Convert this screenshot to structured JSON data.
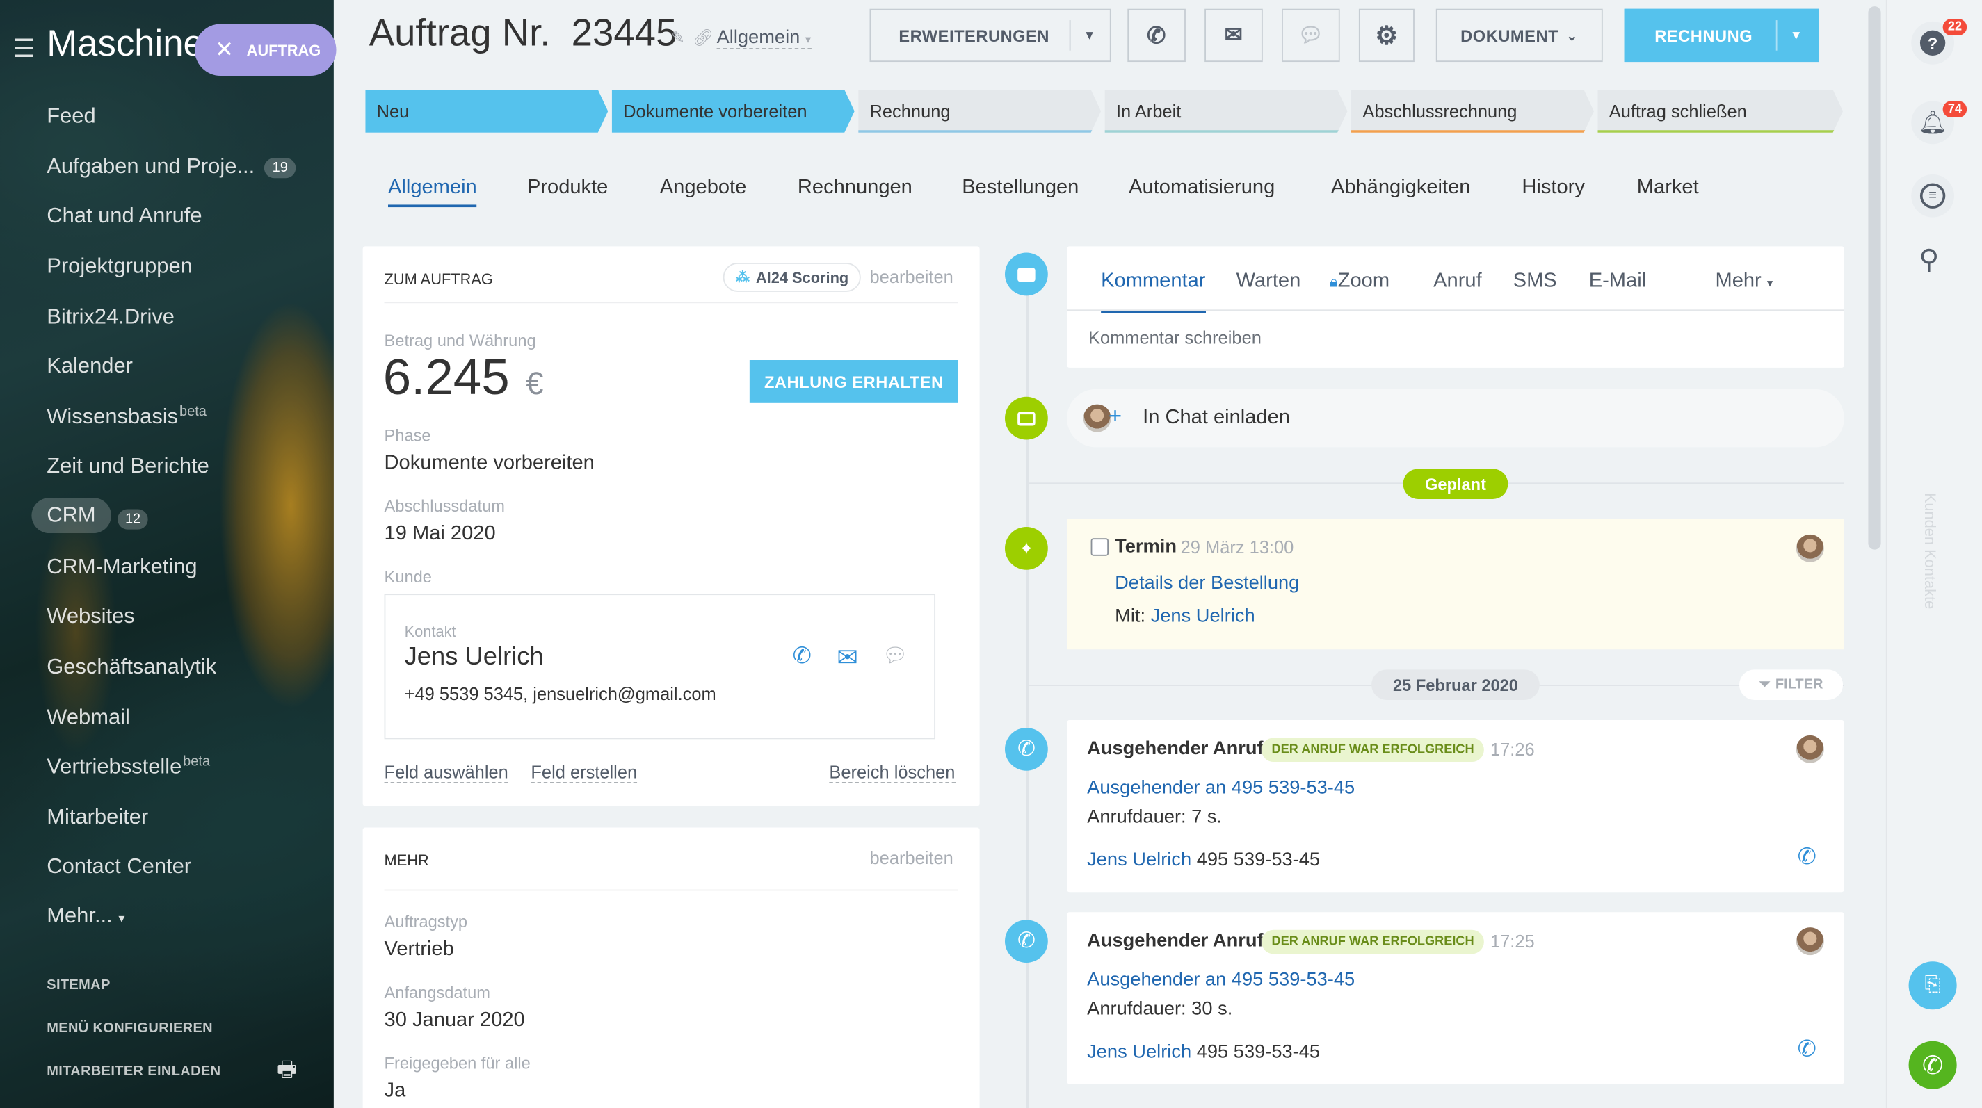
{
  "sidebar": {
    "title": "Maschine",
    "close_pill_label": "AUFTRAG",
    "items": [
      {
        "label": "Feed"
      },
      {
        "label": "Aufgaben und Proje...",
        "count": "19"
      },
      {
        "label": "Chat und Anrufe"
      },
      {
        "label": "Projektgruppen"
      },
      {
        "label": "Bitrix24.Drive"
      },
      {
        "label": "Kalender"
      },
      {
        "label": "Wissensbasis",
        "sup": "beta"
      },
      {
        "label": "Zeit und Berichte"
      },
      {
        "label": "CRM",
        "count": "12"
      },
      {
        "label": "CRM-Marketing"
      },
      {
        "label": "Websites"
      },
      {
        "label": "Geschäftsanalytik"
      },
      {
        "label": "Webmail"
      },
      {
        "label": "Vertriebsstelle",
        "sup": "beta"
      },
      {
        "label": "Mitarbeiter"
      },
      {
        "label": "Contact Center"
      },
      {
        "label": "Mehr..."
      }
    ],
    "sitemap": "SITEMAP",
    "configure": "MENÜ KONFIGURIEREN",
    "invite": "MITARBEITER EINLADEN"
  },
  "header": {
    "title": "Auftrag Nr.  23445",
    "category": "Allgemein",
    "extensions_label": "ERWEITERUNGEN",
    "document_label": "DOKUMENT",
    "invoice_label": "RECHNUNG"
  },
  "stages": [
    {
      "label": "Neu",
      "color": "#55c2ed"
    },
    {
      "label": "Dokumente vorbereiten",
      "color": "#55c2ed"
    },
    {
      "label": "Rechnung",
      "color": "#8fc8e6"
    },
    {
      "label": "In Arbeit",
      "color": "#9ed3d5"
    },
    {
      "label": "Abschlussrechnung",
      "color": "#f3a04d"
    },
    {
      "label": "Auftrag schließen",
      "color": "#a6cf4c"
    }
  ],
  "tabs": [
    "Allgemein",
    "Produkte",
    "Angebote",
    "Rechnungen",
    "Bestellungen",
    "Automatisierung",
    "Abhängigkeiten",
    "History",
    "Market"
  ],
  "order_card": {
    "title": "ZUM AUFTRAG",
    "scoring": "AI24 Scoring",
    "edit": "bearbeiten",
    "amount_label": "Betrag und Währung",
    "amount": "6.245",
    "currency": "€",
    "pay_button": "ZAHLUNG ERHALTEN",
    "phase_label": "Phase",
    "phase": "Dokumente vorbereiten",
    "close_date_label": "Abschlussdatum",
    "close_date": "19 Mai 2020",
    "customer_label": "Kunde",
    "contact_label": "Kontakt",
    "contact_name": "Jens Uelrich",
    "contact_info": "+49 5539 5345, jensuelrich@gmail.com",
    "select_field": "Feld auswählen",
    "create_field": "Feld erstellen",
    "delete_section": "Bereich löschen"
  },
  "more_card": {
    "title": "MEHR",
    "edit": "bearbeiten",
    "type_label": "Auftragstyp",
    "type": "Vertrieb",
    "start_label": "Anfangsdatum",
    "start": "30 Januar 2020",
    "shared_label": "Freigegeben für alle",
    "shared": "Ja"
  },
  "activity": {
    "tabs": [
      "Kommentar",
      "Warten",
      "Zoom",
      "Anruf",
      "SMS",
      "E-Mail",
      "Mehr"
    ],
    "placeholder": "Kommentar schreiben",
    "invite_chat": "In Chat einladen",
    "planned": "Geplant",
    "date_sep": "25 Februar 2020",
    "filter": "FILTER"
  },
  "meeting": {
    "title": "Termin",
    "time": "29 März 13:00",
    "subject": "Details der Bestellung",
    "with_label": "Mit:",
    "with": "Jens Uelrich"
  },
  "calls": [
    {
      "title": "Ausgehender Anruf",
      "badge": "DER ANRUF WAR ERFOLGREICH",
      "time": "17:26",
      "target": "Ausgehender an 495 539-53-45",
      "duration": "Anrufdauer: 7 s.",
      "contact": "Jens Uelrich",
      "phone": "495 539-53-45"
    },
    {
      "title": "Ausgehender Anruf",
      "badge": "DER ANRUF WAR ERFOLGREICH",
      "time": "17:25",
      "target": "Ausgehender an 495 539-53-45",
      "duration": "Anrufdauer: 30 s.",
      "contact": "Jens Uelrich",
      "phone": "495 539-53-45"
    }
  ],
  "right": {
    "help_count": "22",
    "notif_count": "74",
    "vertical_text": "Kunden Kontakte"
  }
}
